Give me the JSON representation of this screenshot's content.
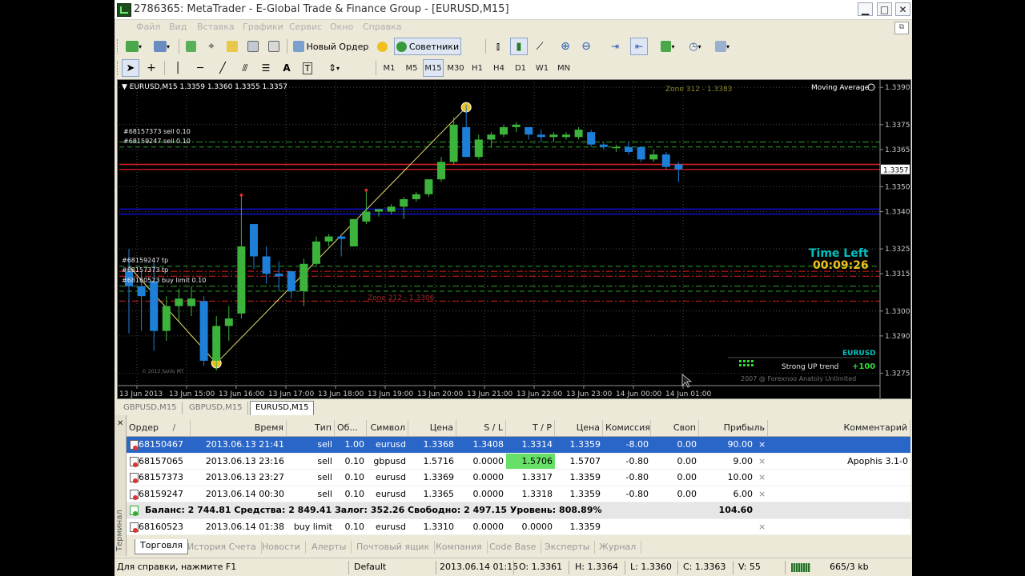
{
  "window": {
    "title": "2786365: MetaTrader - E-Global Trade & Finance Group - [EURUSD,M15]",
    "min_glyph": "▁",
    "max_glyph": "□",
    "close_glyph": "✕"
  },
  "menu": {
    "items": [
      "Файл",
      "Вид",
      "Вставка",
      "Графики",
      "Сервис",
      "Окно",
      "Справка"
    ]
  },
  "toolbar": {
    "new_order": "Новый Ордер",
    "experts": "Советники"
  },
  "timeframes": [
    "M1",
    "M5",
    "M15",
    "M30",
    "H1",
    "H4",
    "D1",
    "W1",
    "MN"
  ],
  "active_timeframe": "M15",
  "chart": {
    "header": "EURUSD,M15  1.3359 1.3360 1.3355 1.3357",
    "indicator_label": "Moving Average",
    "zone_top": "Zone 312 - 1.3383",
    "zone_mid": "Zone 212 - 1.3306",
    "order_labels": [
      "#68157373 sell 0.10",
      "#68159247 sell 0.10"
    ],
    "left_labels": [
      "#68159247 tp",
      "#68157373 tp",
      "#68160523 buy limit 0.10"
    ],
    "time_left_title": "Time Left",
    "time_left_value": "00:09:26",
    "symbol_badge": "EURUSD",
    "trend_text": "Strong UP trend",
    "trend_value": "+100",
    "copyright": "2007 @ Forexnoo Anatoly Unlimited",
    "small_corner_text": "© 2013 Sanlo MT"
  },
  "chart_data": {
    "type": "candlestick",
    "symbol": "EURUSD",
    "timeframe": "M15",
    "ylim": [
      1.327,
      1.3392
    ],
    "y_ticks": [
      "1.3390",
      "1.3375",
      "1.3365",
      "1.3357",
      "1.3350",
      "1.3340",
      "1.3325",
      "1.3315",
      "1.3300",
      "1.3290",
      "1.3275"
    ],
    "x_ticks": [
      "13 Jun 2013",
      "13 Jun 15:00",
      "13 Jun 16:00",
      "13 Jun 17:00",
      "13 Jun 18:00",
      "13 Jun 19:00",
      "13 Jun 20:00",
      "13 Jun 21:00",
      "13 Jun 22:00",
      "13 Jun 23:00",
      "14 Jun 00:00",
      "14 Jun 01:00"
    ],
    "current_price": "1.3357",
    "candles": [
      {
        "o": 1.3316,
        "h": 1.3325,
        "l": 1.3291,
        "c": 1.331
      },
      {
        "o": 1.331,
        "h": 1.3316,
        "l": 1.3292,
        "c": 1.3306
      },
      {
        "o": 1.3312,
        "h": 1.332,
        "l": 1.3284,
        "c": 1.3292
      },
      {
        "o": 1.3292,
        "h": 1.3306,
        "l": 1.3288,
        "c": 1.3302
      },
      {
        "o": 1.3302,
        "h": 1.3309,
        "l": 1.3296,
        "c": 1.3305
      },
      {
        "o": 1.3302,
        "h": 1.331,
        "l": 1.3298,
        "c": 1.3305
      },
      {
        "o": 1.3304,
        "h": 1.3306,
        "l": 1.3278,
        "c": 1.328
      },
      {
        "o": 1.328,
        "h": 1.3298,
        "l": 1.3276,
        "c": 1.3294
      },
      {
        "o": 1.3294,
        "h": 1.3302,
        "l": 1.3288,
        "c": 1.3297
      },
      {
        "o": 1.3299,
        "h": 1.3346,
        "l": 1.3297,
        "c": 1.3326
      },
      {
        "o": 1.3335,
        "h": 1.3335,
        "l": 1.3317,
        "c": 1.3322
      },
      {
        "o": 1.3322,
        "h": 1.3326,
        "l": 1.3311,
        "c": 1.3315
      },
      {
        "o": 1.3315,
        "h": 1.332,
        "l": 1.3308,
        "c": 1.3314
      },
      {
        "o": 1.3316,
        "h": 1.3316,
        "l": 1.3305,
        "c": 1.3308
      },
      {
        "o": 1.3308,
        "h": 1.3321,
        "l": 1.3302,
        "c": 1.3319
      },
      {
        "o": 1.3319,
        "h": 1.333,
        "l": 1.3318,
        "c": 1.3328
      },
      {
        "o": 1.3328,
        "h": 1.3331,
        "l": 1.3326,
        "c": 1.333
      },
      {
        "o": 1.333,
        "h": 1.3331,
        "l": 1.3322,
        "c": 1.3329
      },
      {
        "o": 1.3326,
        "h": 1.3337,
        "l": 1.3326,
        "c": 1.3337
      },
      {
        "o": 1.3336,
        "h": 1.3348,
        "l": 1.3335,
        "c": 1.334
      },
      {
        "o": 1.334,
        "h": 1.3341,
        "l": 1.3338,
        "c": 1.3341
      },
      {
        "o": 1.334,
        "h": 1.3343,
        "l": 1.3339,
        "c": 1.3342
      },
      {
        "o": 1.3342,
        "h": 1.3346,
        "l": 1.3337,
        "c": 1.3345
      },
      {
        "o": 1.3345,
        "h": 1.3348,
        "l": 1.3344,
        "c": 1.3347
      },
      {
        "o": 1.3347,
        "h": 1.3353,
        "l": 1.3346,
        "c": 1.3353
      },
      {
        "o": 1.3353,
        "h": 1.3362,
        "l": 1.3352,
        "c": 1.336
      },
      {
        "o": 1.336,
        "h": 1.3378,
        "l": 1.3359,
        "c": 1.3375
      },
      {
        "o": 1.3374,
        "h": 1.3383,
        "l": 1.3362,
        "c": 1.3362
      },
      {
        "o": 1.3362,
        "h": 1.3371,
        "l": 1.3361,
        "c": 1.3369
      },
      {
        "o": 1.3369,
        "h": 1.3372,
        "l": 1.3366,
        "c": 1.3371
      },
      {
        "o": 1.3371,
        "h": 1.3375,
        "l": 1.337,
        "c": 1.3374
      },
      {
        "o": 1.3374,
        "h": 1.3376,
        "l": 1.3372,
        "c": 1.3375
      },
      {
        "o": 1.3374,
        "h": 1.3374,
        "l": 1.3369,
        "c": 1.3371
      },
      {
        "o": 1.3371,
        "h": 1.3373,
        "l": 1.3368,
        "c": 1.337
      },
      {
        "o": 1.337,
        "h": 1.3372,
        "l": 1.3368,
        "c": 1.3371
      },
      {
        "o": 1.337,
        "h": 1.3372,
        "l": 1.3369,
        "c": 1.3371
      },
      {
        "o": 1.337,
        "h": 1.3374,
        "l": 1.3369,
        "c": 1.3373
      },
      {
        "o": 1.3372,
        "h": 1.3373,
        "l": 1.3366,
        "c": 1.3367
      },
      {
        "o": 1.3367,
        "h": 1.3368,
        "l": 1.3365,
        "c": 1.3366
      },
      {
        "o": 1.3366,
        "h": 1.3367,
        "l": 1.3364,
        "c": 1.3366
      },
      {
        "o": 1.3366,
        "h": 1.3368,
        "l": 1.3363,
        "c": 1.3364
      },
      {
        "o": 1.3366,
        "h": 1.3366,
        "l": 1.336,
        "c": 1.3361
      },
      {
        "o": 1.3361,
        "h": 1.3365,
        "l": 1.336,
        "c": 1.3363
      },
      {
        "o": 1.3363,
        "h": 1.3364,
        "l": 1.3357,
        "c": 1.3358
      },
      {
        "o": 1.3359,
        "h": 1.336,
        "l": 1.3352,
        "c": 1.3357
      }
    ],
    "horizontal_levels": [
      {
        "price": 1.3366,
        "color": "#2ea02e",
        "style": "dash"
      },
      {
        "price": 1.3368,
        "color": "#2ea02e",
        "style": "dashdot"
      },
      {
        "price": 1.3359,
        "color": "#e02020",
        "style": "solid"
      },
      {
        "price": 1.3357,
        "color": "#c01818",
        "style": "solid"
      },
      {
        "price": 1.3339,
        "color": "#1010d0",
        "style": "solid"
      },
      {
        "price": 1.3341,
        "color": "#1010d0",
        "style": "solid"
      },
      {
        "price": 1.3316,
        "color": "#e02020",
        "style": "dashdot"
      },
      {
        "price": 1.3314,
        "color": "#e02020",
        "style": "dashdot"
      },
      {
        "price": 1.3318,
        "color": "#2ea02e",
        "style": "dash"
      },
      {
        "price": 1.331,
        "color": "#2ea02e",
        "style": "dashdot"
      },
      {
        "price": 1.3308,
        "color": "#2ea02e",
        "style": "dash"
      },
      {
        "price": 1.3304,
        "color": "#e02020",
        "style": "dashdot"
      }
    ],
    "zigzag": [
      {
        "candle": 0,
        "price": 1.3318
      },
      {
        "candle": 7,
        "price": 1.3279
      },
      {
        "candle": 27,
        "price": 1.3382
      }
    ],
    "colors": {
      "bull": "#3cb43c",
      "bear": "#1e7fd8",
      "grid": "#4a4a4a",
      "zigzag": "#e8e070",
      "axis_text": "#c8c8c8",
      "current_price_bg": "#ffffff"
    }
  },
  "chart_tabs": [
    "GBPUSD,M15",
    "GBPUSD,M15",
    "EURUSD,M15"
  ],
  "active_chart_tab": 2,
  "terminal": {
    "vertical_label": "Терминал",
    "columns": [
      "Ордер",
      "/",
      "Время",
      "Тип",
      "Об...",
      "Символ",
      "Цена",
      "S / L",
      "T / P",
      "Цена",
      "Комиссия",
      "Своп",
      "Прибыль",
      "Комментарий"
    ],
    "rows": [
      {
        "order": "68150467",
        "time": "2013.06.13 21:41",
        "type": "sell",
        "volume": "1.00",
        "symbol": "eurusd",
        "price": "1.3368",
        "sl": "1.3408",
        "tp": "1.3314",
        "cur": "1.3359",
        "commission": "-8.00",
        "swap": "0.00",
        "profit": "90.00",
        "close": "×",
        "comment": ""
      },
      {
        "order": "68157065",
        "time": "2013.06.13 23:16",
        "type": "sell",
        "volume": "0.10",
        "symbol": "gbpusd",
        "price": "1.5716",
        "sl": "0.0000",
        "tp": "1.5706",
        "cur": "1.5707",
        "commission": "-0.80",
        "swap": "0.00",
        "profit": "9.00",
        "close": "×",
        "comment": "Apophis 3.1-0"
      },
      {
        "order": "68157373",
        "time": "2013.06.13 23:27",
        "type": "sell",
        "volume": "0.10",
        "symbol": "eurusd",
        "price": "1.3369",
        "sl": "0.0000",
        "tp": "1.3317",
        "cur": "1.3359",
        "commission": "-0.80",
        "swap": "0.00",
        "profit": "10.00",
        "close": "×",
        "comment": ""
      },
      {
        "order": "68159247",
        "time": "2013.06.14 00:30",
        "type": "sell",
        "volume": "0.10",
        "symbol": "eurusd",
        "price": "1.3365",
        "sl": "0.0000",
        "tp": "1.3318",
        "cur": "1.3359",
        "commission": "-0.80",
        "swap": "0.00",
        "profit": "6.00",
        "close": "×",
        "comment": ""
      }
    ],
    "balance_text": "Баланс: 2 744.81  Средства: 2 849.41  Залог: 352.26  Свободно: 2 497.15  Уровень: 808.89%",
    "balance_profit": "104.60",
    "pending": {
      "order": "68160523",
      "time": "2013.06.14 01:38",
      "type": "buy limit",
      "volume": "0.10",
      "symbol": "eurusd",
      "price": "1.3310",
      "sl": "0.0000",
      "tp": "0.0000",
      "cur": "1.3359",
      "close": "×"
    },
    "tabs": [
      "Торговля",
      "История Счета",
      "Новости",
      "Алерты",
      "Почтовый ящик",
      "Компания",
      "Code Base",
      "Эксперты",
      "Журнал"
    ]
  },
  "status": {
    "help": "Для справки, нажмите F1",
    "profile": "Default",
    "datetime": "2013.06.14 01:15",
    "open": "O: 1.3361",
    "high": "H: 1.3364",
    "low": "L: 1.3360",
    "close": "C: 1.3363",
    "volume": "V: 55",
    "traffic": "665/3 kb"
  }
}
